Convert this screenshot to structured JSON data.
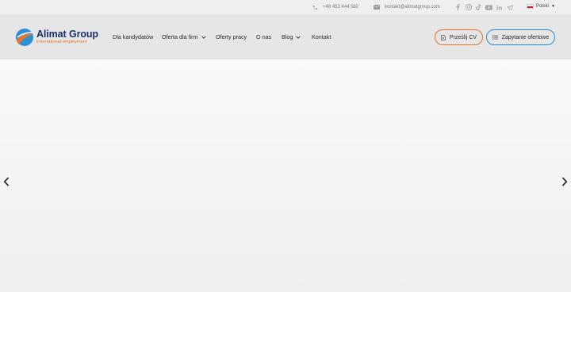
{
  "topbar": {
    "phone": "+48 453 444 562",
    "email": "kontakt@alimatgroup.com",
    "socials": [
      "facebook-icon",
      "instagram-icon",
      "tiktok-icon",
      "youtube-icon",
      "linkedin-icon",
      "telegram-icon"
    ],
    "language": "Polski"
  },
  "logo": {
    "name": "Alimat Group",
    "tagline": "international employment"
  },
  "nav": {
    "items": [
      {
        "label": "Dla kandydatów",
        "dropdown": false
      },
      {
        "label": "Oferta dla firm",
        "dropdown": true
      },
      {
        "label": "Oferty pracy",
        "dropdown": false
      },
      {
        "label": "O nas",
        "dropdown": false
      },
      {
        "label": "Blog",
        "dropdown": true
      },
      {
        "label": "Kontakt",
        "dropdown": false
      }
    ]
  },
  "buttons": {
    "send_cv": "Prześlij CV",
    "quote_request": "Zapytanie ofertowe"
  },
  "colors": {
    "brand_navy": "#1a2f6b",
    "brand_orange": "#e8742a",
    "brand_blue": "#2d8fd6",
    "header_bg": "#e6e6e6",
    "topbar_bg": "#efefef"
  }
}
